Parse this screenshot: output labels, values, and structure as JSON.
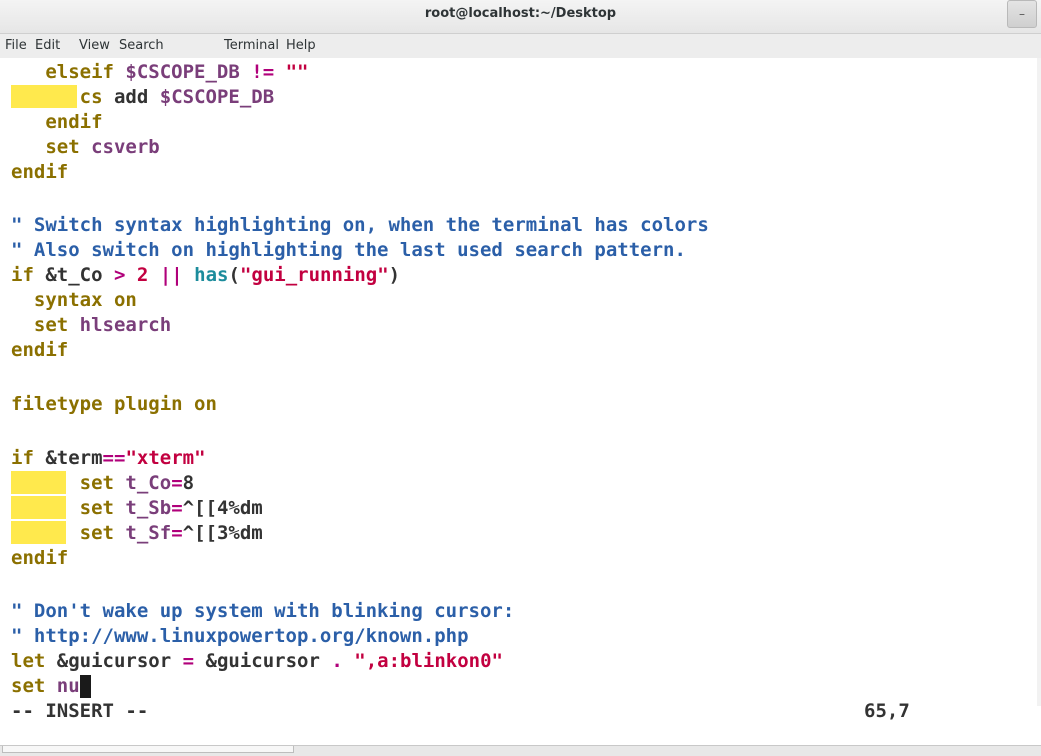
{
  "window": {
    "title": "root@localhost:~/Desktop",
    "minimize_glyph": "–"
  },
  "menu": [
    "File",
    "Edit",
    "View",
    "Search",
    "Terminal",
    "Help"
  ],
  "colors": {
    "keyword": "#8b7000",
    "variable": "#7a3e7a",
    "string": "#c20040",
    "comment": "#2b5fa8",
    "function": "#1c8c9c",
    "highlight": "#ffe94d"
  },
  "editor": {
    "l1": {
      "kw": "elseif",
      "var": "$CSCOPE_DB",
      "op": "!=",
      "str": "\"\""
    },
    "l2": {
      "kw": "cs",
      "plain": "add",
      "var": "$CSCOPE_DB"
    },
    "l3": {
      "kw": "endif"
    },
    "l4": {
      "kw": "set",
      "opt": "csverb"
    },
    "l5": {
      "kw": "endif"
    },
    "l7": {
      "comment": "\" Switch syntax highlighting on, when the terminal has colors"
    },
    "l8": {
      "comment": "\" Also switch on highlighting the last used search pattern."
    },
    "l9": {
      "kw": "if",
      "var": "&t_Co",
      "op1": ">",
      "num": "2",
      "op2": "||",
      "fn": "has",
      "open": "(",
      "str": "\"gui_running\"",
      "close": ")"
    },
    "l10": {
      "kw": "syntax",
      "arg": "on"
    },
    "l11": {
      "kw": "set",
      "opt": "hlsearch"
    },
    "l12": {
      "kw": "endif"
    },
    "l14": {
      "kw": "filetype",
      "arg": "plugin on"
    },
    "l16": {
      "kw": "if",
      "var": "&term",
      "op": "==",
      "str": "\"xterm\""
    },
    "l17": {
      "kw": "set",
      "opt": "t_Co",
      "eq": "=",
      "val": "8"
    },
    "l18": {
      "kw": "set",
      "opt": "t_Sb",
      "eq": "=",
      "val": "^[[4%dm"
    },
    "l19": {
      "kw": "set",
      "opt": "t_Sf",
      "eq": "=",
      "val": "^[[3%dm"
    },
    "l20": {
      "kw": "endif"
    },
    "l22": {
      "comment": "\" Don't wake up system with blinking cursor:"
    },
    "l23": {
      "comment": "\" http://www.linuxpowertop.org/known.php"
    },
    "l24": {
      "kw": "let",
      "var": "&guicursor",
      "eq": "=",
      "var2": "&guicursor",
      "dot": ".",
      "str": "\",a:blinkon0\""
    },
    "l25": {
      "kw": "set",
      "opt": "nu"
    }
  },
  "status": {
    "mode": "-- INSERT --",
    "position": "65,7"
  }
}
